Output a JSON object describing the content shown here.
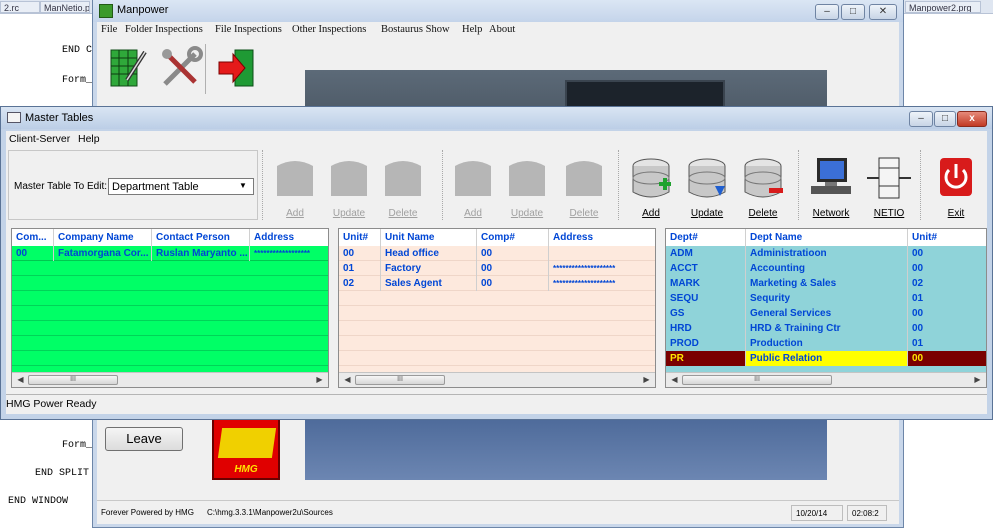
{
  "editor": {
    "tabs": [
      "2.rc",
      "ManNetio.p",
      "Manpower2.prg"
    ],
    "code": {
      "end_1": "END C",
      "form_1": "Form_",
      "form_2": "Form_",
      "end_split": "END SPLIT",
      "end_window": "END WINDOW"
    }
  },
  "manpower": {
    "title": "Manpower",
    "menu": [
      "File",
      "Folder Inspections",
      "File Inspections",
      "Other Inspections",
      "Bostaurus Show",
      "Help",
      "About"
    ],
    "leave_label": "Leave",
    "logo_text": "HMG",
    "status": {
      "powered": "Forever Powered by HMG",
      "path": "C:\\hmg.3.3.1\\Manpower2u\\Sources",
      "date": "10/20/14",
      "time": "02:08:2"
    }
  },
  "master": {
    "title": "Master Tables",
    "menu": [
      "Client-Server",
      "Help"
    ],
    "table_select_label": "Master Table To Edit:",
    "table_select_value": "Department Table",
    "toolbar": {
      "group1": [
        "Add",
        "Update",
        "Delete"
      ],
      "group2": [
        "Add",
        "Update",
        "Delete"
      ],
      "group3": [
        "Add",
        "Update",
        "Delete"
      ],
      "network": "Network",
      "netio": "NETIO",
      "exit": "Exit"
    },
    "status": "HMG Power Ready",
    "company_grid": {
      "headers": [
        "Com...",
        "Company Name",
        "Contact Person",
        "Address"
      ],
      "rows": [
        [
          "00",
          "Fatamorgana Cor...",
          "Ruslan Maryanto ...",
          "******************"
        ]
      ]
    },
    "unit_grid": {
      "headers": [
        "Unit#",
        "Unit Name",
        "Comp#",
        "Address"
      ],
      "rows": [
        [
          "00",
          "Head office",
          "00",
          ""
        ],
        [
          "01",
          "Factory",
          "00",
          "********************"
        ],
        [
          "02",
          "Sales Agent",
          "00",
          "********************"
        ]
      ]
    },
    "dept_grid": {
      "headers": [
        "Dept#",
        "Dept Name",
        "Unit#"
      ],
      "rows": [
        [
          "ADM",
          "Administratioon",
          "00"
        ],
        [
          "ACCT",
          "Accounting",
          "00"
        ],
        [
          "MARK",
          "Marketing & Sales",
          "02"
        ],
        [
          "SEQU",
          "Sequrity",
          "01"
        ],
        [
          "GS",
          "General Services",
          "00"
        ],
        [
          "HRD",
          "HRD & Training Ctr",
          "00"
        ],
        [
          "PROD",
          "Production",
          "01"
        ],
        [
          "PR",
          "Public Relation",
          "00"
        ]
      ],
      "selected_row": 7
    },
    "colors": {
      "company_bg": "#00ff66",
      "unit_bg": "#fde9dd",
      "dept_bg": "#8fd3d9",
      "selected_code_bg": "#7a0000",
      "selected_name_bg": "#ffff00",
      "header_text": "#0046d5"
    }
  }
}
